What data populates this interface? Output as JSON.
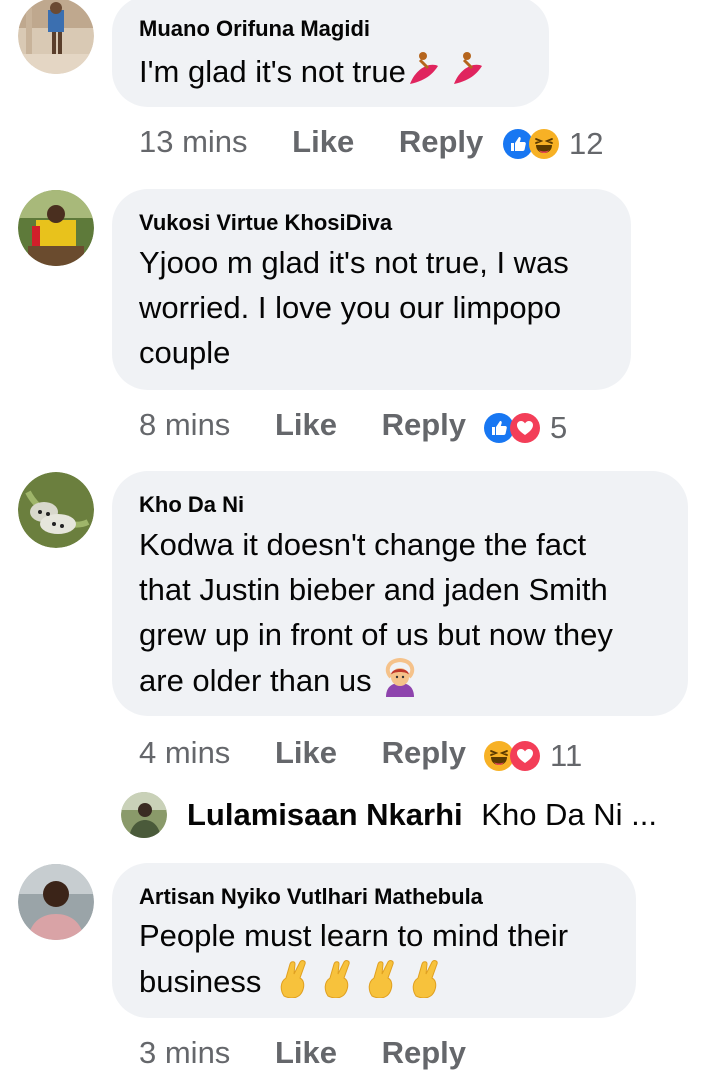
{
  "comments": [
    {
      "author": "Muano Orifuna Magidi",
      "text_lines": [
        "I'm glad it's not true"
      ],
      "time": "13 mins",
      "like": "Like",
      "reply": "Reply",
      "reactions": [
        "like-icon",
        "haha-icon"
      ],
      "reaction_count": "12"
    },
    {
      "author": "Vukosi Virtue KhosiDiva",
      "text_lines": [
        "Yjooo m glad it's not true, I was",
        "worried. I love you our limpopo",
        "couple"
      ],
      "time": "8 mins",
      "like": "Like",
      "reply": "Reply",
      "reactions": [
        "like-icon",
        "love-icon"
      ],
      "reaction_count": "5"
    },
    {
      "author": "Kho Da Ni",
      "text_lines": [
        "Kodwa  it doesn't change the fact",
        "that Justin bieber and jaden Smith",
        "grew up in front of us but now they",
        "are older than us"
      ],
      "time": "4 mins",
      "like": "Like",
      "reply": "Reply",
      "reactions": [
        "haha-icon",
        "love-icon"
      ],
      "reaction_count": "11",
      "reply_preview": {
        "author": "Lulamisaan Nkarhi",
        "snippet": "Kho Da Ni ..."
      }
    },
    {
      "author": "Artisan Nyiko Vutlhari Mathebula",
      "text_lines": [
        "People must learn to mind their",
        "business"
      ],
      "time": "3 mins",
      "like": "Like",
      "reply": "Reply"
    }
  ],
  "colors": {
    "bubble": "#f0f2f5",
    "meta": "#65676b",
    "like_blue": "#1877f2",
    "love_red": "#f33e58",
    "haha_yellow": "#f7b125"
  },
  "emoji_names": [
    "dancer-emoji",
    "woman-gesturing-ok-emoji",
    "fingers-crossed-emoji"
  ]
}
